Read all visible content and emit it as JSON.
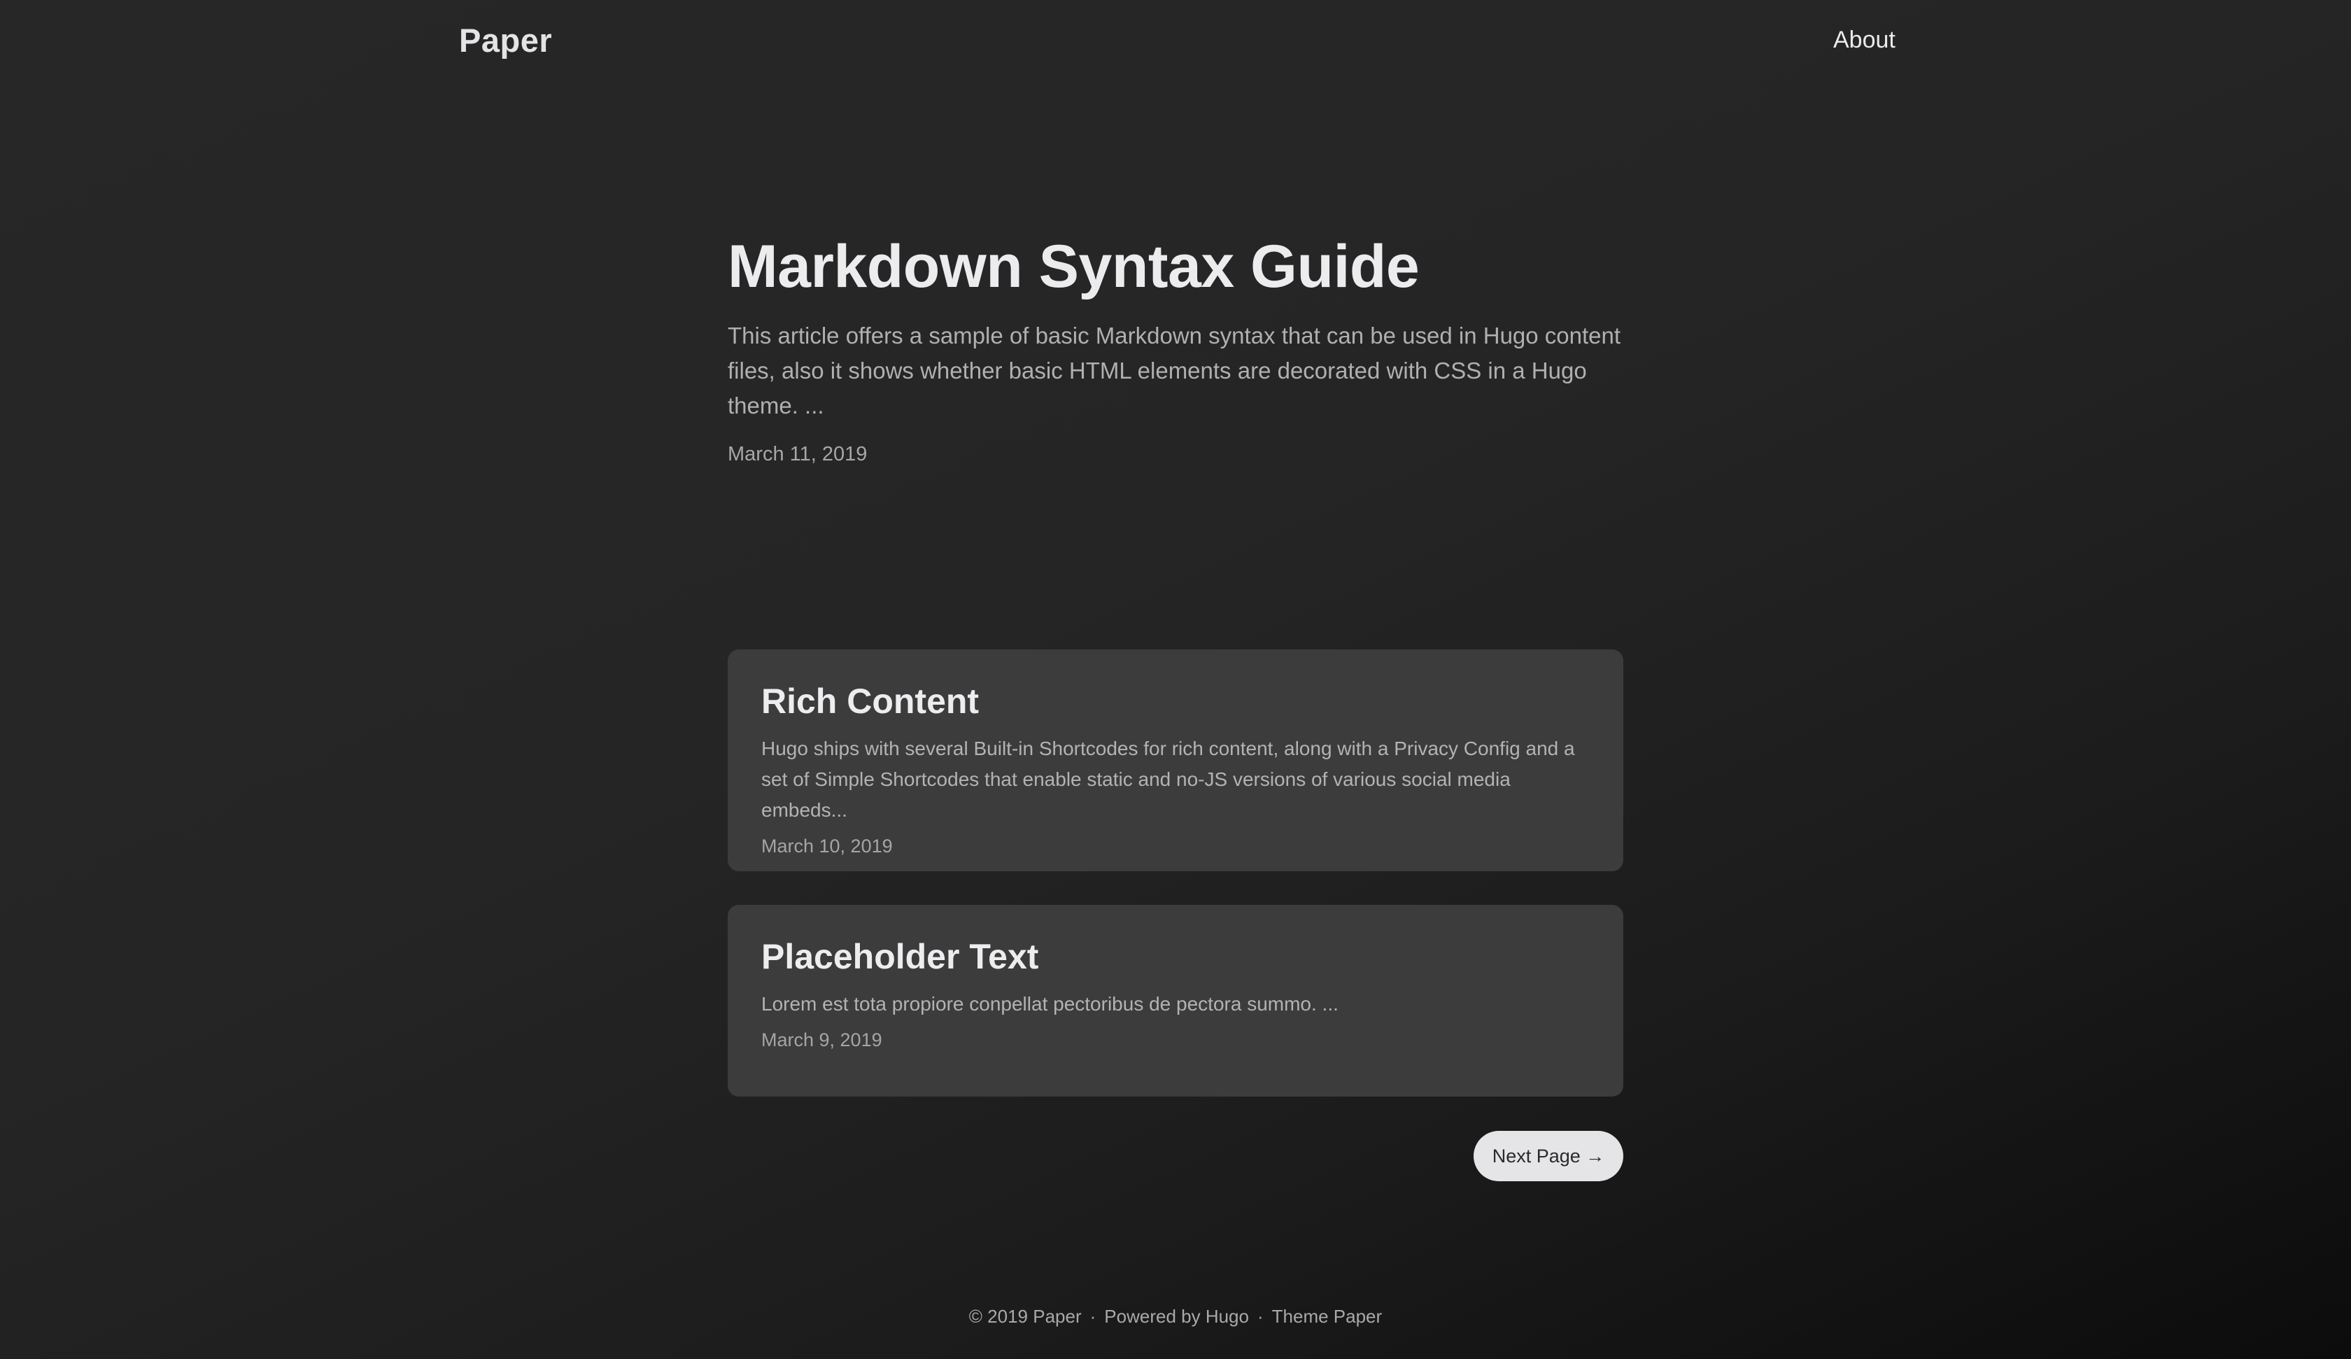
{
  "header": {
    "logo": "Paper",
    "nav": [
      {
        "label": "About"
      }
    ]
  },
  "hero": {
    "title": "Markdown Syntax Guide",
    "excerpt": "This article offers a sample of basic Markdown syntax that can be used in Hugo content files, also it shows whether basic HTML elements are decorated with CSS in a Hugo theme. ...",
    "date": "March 11, 2019"
  },
  "posts": [
    {
      "title": "Rich Content",
      "excerpt": "Hugo ships with several Built-in Shortcodes for rich content, along with a Privacy Config and a set of Simple Shortcodes that enable static and no-JS versions of various social media embeds...",
      "date": "March 10, 2019"
    },
    {
      "title": "Placeholder Text",
      "excerpt": "Lorem est tota propiore conpellat pectoribus de pectora summo. ...",
      "date": "March 9, 2019"
    }
  ],
  "pagination": {
    "next_label": "Next Page →"
  },
  "footer": {
    "copyright": "© 2019 Paper",
    "separator": "·",
    "powered_by": "Powered by Hugo",
    "theme": "Theme Paper"
  },
  "colors": {
    "background": "#252525",
    "card_background": "#3c3c3d",
    "button_background": "#e5e5e7",
    "text_primary": "#ececee",
    "text_secondary": "#b0b0b2"
  }
}
